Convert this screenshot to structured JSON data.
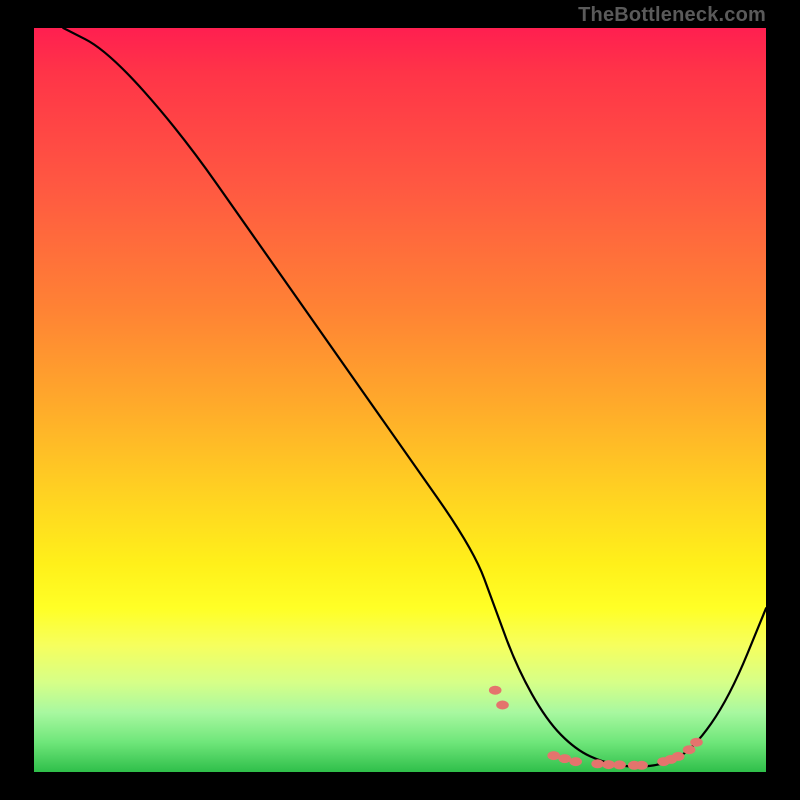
{
  "attribution": "TheBottleneck.com",
  "chart_data": {
    "type": "line",
    "title": "",
    "xlabel": "",
    "ylabel": "",
    "xlim": [
      0,
      100
    ],
    "ylim": [
      0,
      100
    ],
    "grid": false,
    "series": [
      {
        "name": "curve",
        "x": [
          4,
          10,
          20,
          30,
          40,
          50,
          60,
          63,
          66,
          70,
          74,
          78,
          82,
          86,
          90,
          95,
          100
        ],
        "y": [
          100,
          97,
          86,
          72,
          58,
          44,
          30,
          22,
          14,
          7,
          3,
          1.2,
          0.6,
          1,
          3,
          10,
          22
        ],
        "stroke": "#000000",
        "stroke_width": 2.2
      }
    ],
    "markers": {
      "name": "valley-dots",
      "color": "#e4746d",
      "size": 7,
      "points": [
        {
          "x": 63,
          "y": 11
        },
        {
          "x": 64,
          "y": 9
        },
        {
          "x": 71,
          "y": 2.2
        },
        {
          "x": 72.5,
          "y": 1.8
        },
        {
          "x": 74,
          "y": 1.4
        },
        {
          "x": 77,
          "y": 1.1
        },
        {
          "x": 78.5,
          "y": 1.0
        },
        {
          "x": 80,
          "y": 0.95
        },
        {
          "x": 82,
          "y": 0.9
        },
        {
          "x": 83,
          "y": 0.9
        },
        {
          "x": 86,
          "y": 1.4
        },
        {
          "x": 87,
          "y": 1.7
        },
        {
          "x": 88,
          "y": 2.1
        },
        {
          "x": 89.5,
          "y": 3.0
        },
        {
          "x": 90.5,
          "y": 4.0
        }
      ]
    }
  }
}
